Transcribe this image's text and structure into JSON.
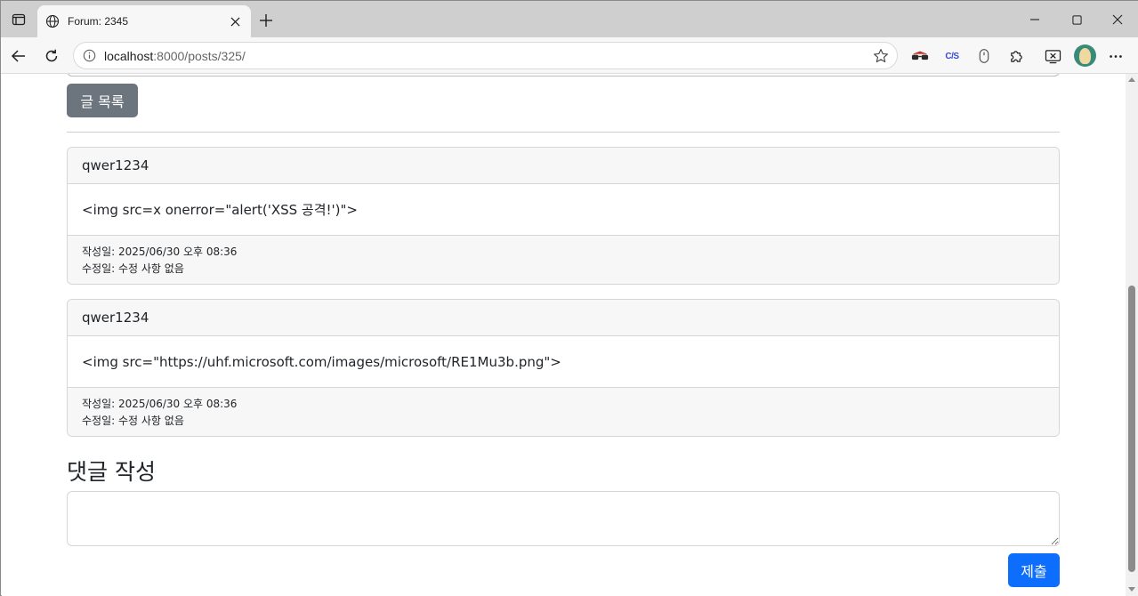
{
  "browser": {
    "tab_title": "Forum: 2345",
    "url_host": "localhost",
    "url_rest": ":8000/posts/325/",
    "extensions": [
      "incognito-glasses-icon",
      "cjs-extension-icon",
      "mouse-icon",
      "puzzle-icon"
    ],
    "ext_cjs_label": "C/S"
  },
  "page": {
    "list_button_label": "글 목록",
    "comments": [
      {
        "author": "qwer1234",
        "content": "<img src=x onerror=\"alert('XSS 공격!')\">",
        "created_label": "작성일: ",
        "created_value": "2025/06/30 오후 08:36",
        "modified_label": "수정일: ",
        "modified_value": "수정 사항 없음"
      },
      {
        "author": "qwer1234",
        "content": "<img src=\"https://uhf.microsoft.com/images/microsoft/RE1Mu3b.png\">",
        "created_label": "작성일: ",
        "created_value": "2025/06/30 오후 08:36",
        "modified_label": "수정일: ",
        "modified_value": "수정 사항 없음"
      }
    ],
    "form_title": "댓글 작성",
    "textarea_value": "",
    "submit_label": "제출"
  },
  "colors": {
    "secondary_button": "#6c757d",
    "primary_button": "#0d6efd",
    "card_header_bg": "#f7f7f7"
  }
}
